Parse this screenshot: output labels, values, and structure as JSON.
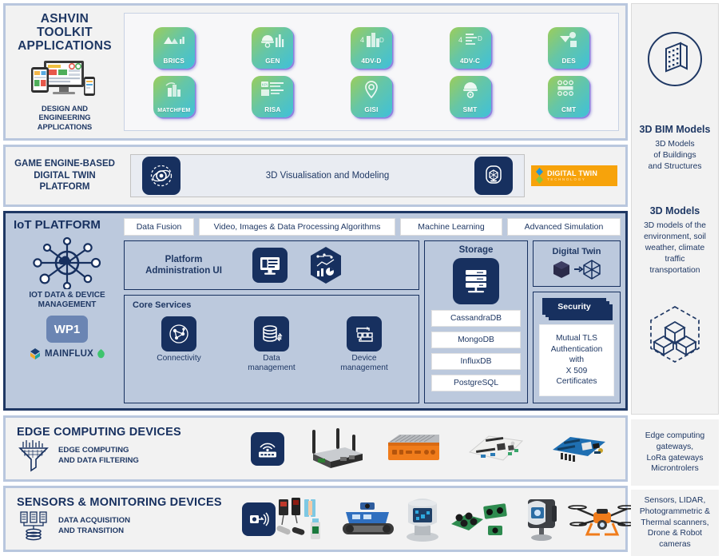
{
  "applications": {
    "title_line1": "ASHVIN",
    "title_line2": "TOOLKIT",
    "title_line3": "APPLICATIONS",
    "subtitle_line1": "DESIGN AND",
    "subtitle_line2": "ENGINEERING",
    "subtitle_line3": "APPLICATIONS",
    "tiles": [
      {
        "label": "BRICS",
        "icon": "mountains-chart-icon"
      },
      {
        "label": "MATCHFEM",
        "icon": "building-crane-icon"
      },
      {
        "label": "GEN",
        "icon": "helmet-bars-icon"
      },
      {
        "label": "RISA",
        "icon": "kpi-dashboard-icon"
      },
      {
        "label": "4DV-D",
        "icon": "4d-building-icon"
      },
      {
        "label": "GISI",
        "icon": "map-pin-icon"
      },
      {
        "label": "4DV-C",
        "icon": "4d-timeline-icon"
      },
      {
        "label": "SMT",
        "icon": "helmet-gear-icon"
      },
      {
        "label": "DES",
        "icon": "crane-site-icon"
      },
      {
        "label": "CMT",
        "icon": "checklist-grid-icon"
      }
    ]
  },
  "game_engine": {
    "title_line1": "GAME ENGINE-BASED",
    "title_line2": "DIGITAL TWIN",
    "title_line3": "PLATFORM",
    "center_text": "3D Visualisation and Modeling",
    "logo_name": "DIGITAL TWIN",
    "logo_sub": "TECHNOLOGY"
  },
  "iot": {
    "title": "IoT PLATFORM",
    "left_label_line1": "IOT DATA & DEVICE",
    "left_label_line2": "MANAGEMENT",
    "wp_badge": "WP1",
    "vendor": "MAINFLUX",
    "tabs": [
      "Data Fusion",
      "Video, Images & Data Processing Algorithms",
      "Machine Learning",
      "Advanced Simulation"
    ],
    "admin_label_line1": "Platform",
    "admin_label_line2": "Administration UI",
    "core_services_title": "Core Services",
    "core_services": [
      {
        "label_line1": "Connectivity",
        "label_line2": "",
        "icon": "network-share-icon"
      },
      {
        "label_line1": "Data",
        "label_line2": "management",
        "icon": "database-sync-icon"
      },
      {
        "label_line1": "Device",
        "label_line2": "management",
        "icon": "device-flow-icon"
      }
    ],
    "storage_title": "Storage",
    "storage_icon": "server-rack-icon",
    "databases": [
      "CassandraDB",
      "MongoDB",
      "InfluxDB",
      "PostgreSQL"
    ],
    "digital_twin_title": "Digital Twin",
    "digital_twin_icon": "cube-to-wireframe-icon",
    "security_title": "Security",
    "security_text_line1": "Mutual TLS",
    "security_text_line2": "Authentication",
    "security_text_line3": "with",
    "security_text_line4": "X 509",
    "security_text_line5": "Certificates"
  },
  "edge": {
    "title": "EDGE COMPUTING  DEVICES",
    "sub_line1": "EDGE COMPUTING",
    "sub_line2": "AND DATA FILTERING",
    "filter_icon": "data-funnel-icon",
    "router_icon": "wireless-router-icon",
    "devices": [
      "industrial-router-photo",
      "fanless-pc-photo",
      "dev-board-photo",
      "iot-shield-board-photo"
    ]
  },
  "sensors": {
    "title": "SENSORS & MONITORING DEVICES",
    "sub_line1": "DATA ACQUISITION",
    "sub_line2": "AND TRANSITION",
    "stack_icon": "sensor-array-icon",
    "signal_icon": "sensor-signal-icon",
    "devices": [
      "photoelectric-sensors-photo",
      "tracked-robot-photo",
      "3d-scanner-head-photo",
      "stereo-camera-photo",
      "laser-scanner-photo",
      "drone-photo"
    ]
  },
  "sidebar": {
    "bim_icon": "building-circle-icon",
    "bim_title": "3D BIM Models",
    "bim_text_line1": "3D Models",
    "bim_text_line2": "of Buildings",
    "bim_text_line3": "and Structures",
    "models_title": "3D Models",
    "models_text_line1": "3D models of the",
    "models_text_line2": "environment, soil",
    "models_text_line3": "weather, climate",
    "models_text_line4": "traffic",
    "models_text_line5": "transportation",
    "cubes_icon": "hex-cubes-icon",
    "edge_text_line1": "Edge computing",
    "edge_text_line2": "gateways,",
    "edge_text_line3": "LoRa gateways",
    "edge_text_line4": "Microntrolers",
    "sensors_text_line1": "Sensors, LIDAR,",
    "sensors_text_line2": "Photogrammetric &",
    "sensors_text_line3": "Thermal scanners,",
    "sensors_text_line4": "Drone & Robot",
    "sensors_text_line5": "cameras"
  },
  "colors": {
    "navy": "#17305f",
    "panel_blue": "#bcc9dd",
    "border_blue": "#b9c7de",
    "orange": "#f7a30b",
    "tile_green": "#9ccd5a",
    "tile_cyan": "#3fc0d9"
  }
}
